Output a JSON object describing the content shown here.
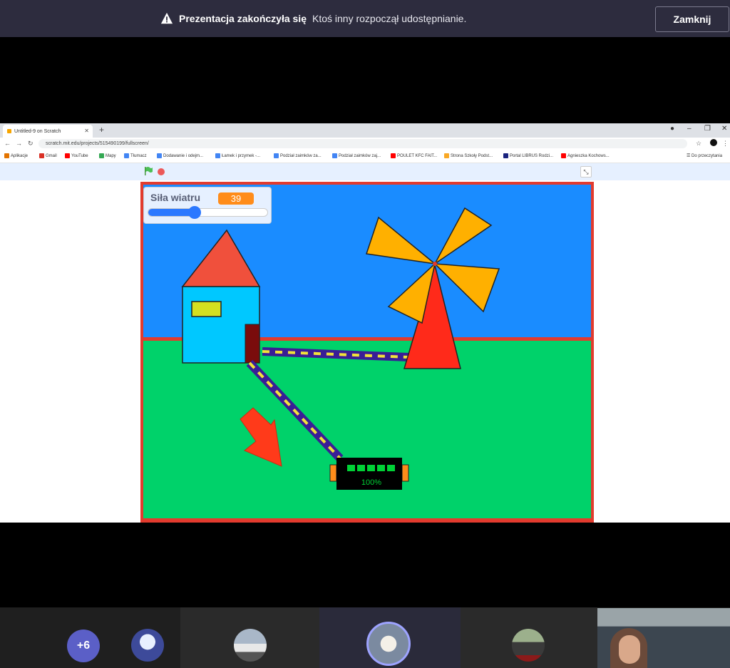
{
  "notification": {
    "title": "Prezentacja zakończyła się",
    "message": "Ktoś inny rozpoczął udostępnianie.",
    "close_label": "Zamknij"
  },
  "browser": {
    "tab_title": "Untitled-9 on Scratch",
    "url": "scratch.mit.edu/projects/515490199/fullscreen/",
    "bookmarks": [
      {
        "label": "Aplikacje",
        "icon": "apps-icon",
        "color": "#e37400"
      },
      {
        "label": "Gmail",
        "icon": "gmail-icon",
        "color": "#d93025"
      },
      {
        "label": "YouTube",
        "icon": "youtube-icon",
        "color": "#ff0000"
      },
      {
        "label": "Mapy",
        "icon": "maps-icon",
        "color": "#34a853"
      },
      {
        "label": "Tłumacz",
        "icon": "translate-icon",
        "color": "#4285f4"
      },
      {
        "label": "Dodawanie i odejm...",
        "icon": "page-icon",
        "color": "#4285f4"
      },
      {
        "label": "Łamek i przymek -...",
        "icon": "page-icon",
        "color": "#4285f4"
      },
      {
        "label": "Podział zaimków za...",
        "icon": "page-icon",
        "color": "#4285f4"
      },
      {
        "label": "Podział zaimków zaj...",
        "icon": "page-icon",
        "color": "#4285f4"
      },
      {
        "label": "POULET KFC FAIT...",
        "icon": "youtube-icon",
        "color": "#ff0000"
      },
      {
        "label": "Strona Szkoły Podst...",
        "icon": "school-icon",
        "color": "#f9a825"
      },
      {
        "label": "Portal LIBRUS Rodzi...",
        "icon": "librus-icon",
        "color": "#1a237e"
      },
      {
        "label": "Agnieszka Kochows...",
        "icon": "youtube-icon",
        "color": "#ff0000"
      }
    ],
    "reading_list": "Do przeczytania"
  },
  "scratch": {
    "monitor_label": "Siła wiatru",
    "monitor_value": "39",
    "slider_fraction": 0.39,
    "battery_label": "100%",
    "colors": {
      "sky": "#1a8cff",
      "grass": "#00d26a",
      "border": "#e23b2e",
      "house_roof": "#f0503c",
      "house_wall": "#00c8ff",
      "window": "#d4e020",
      "door": "#7a0c0c",
      "windmill_tower": "#ff2a1a",
      "blades": "#ffb000",
      "cable": "#3a1d96",
      "arrow": "#ff3a1a",
      "battery": "#000000",
      "battery_cells": "#00d236"
    }
  },
  "participants": {
    "more_count": "+6"
  }
}
